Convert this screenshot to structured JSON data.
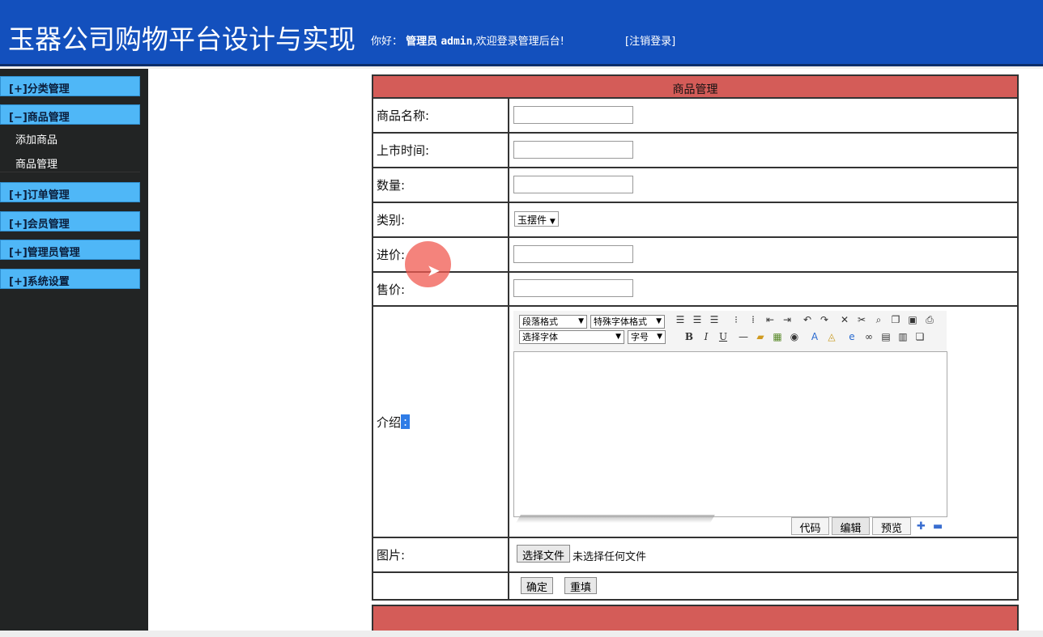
{
  "header": {
    "title": "玉器公司购物平台设计与实现",
    "greeting_prefix": "你好：",
    "role": "管理员",
    "username": "admin",
    "greeting_suffix": ",欢迎登录管理后台!",
    "logout": "[注销登录]"
  },
  "sidebar": {
    "menus": [
      {
        "label": "[+]分类管理"
      },
      {
        "label": "[−]商品管理"
      },
      {
        "label": "[+]订单管理"
      },
      {
        "label": "[+]会员管理"
      },
      {
        "label": "[+]管理员管理"
      },
      {
        "label": "[+]系统设置"
      }
    ],
    "sub_items": [
      {
        "label": "添加商品"
      },
      {
        "label": "商品管理"
      }
    ]
  },
  "form": {
    "title": "商品管理",
    "name_label": "商品名称:",
    "date_label": "上市时间:",
    "qty_label": "数量:",
    "category_label": "类别:",
    "category_value": "玉摆件",
    "cost_label": "进价:",
    "price_label": "售价:",
    "intro_label": "介绍",
    "intro_colon": ":",
    "image_label": "图片:",
    "choose_file": "选择文件",
    "no_file": "未选择任何文件",
    "submit": "确定",
    "reset": "重填"
  },
  "editor": {
    "paragraph_format": "段落格式",
    "special_font_format": "特殊字体格式",
    "choose_font": "选择字体",
    "font_size": "字号",
    "mode_code": "代码",
    "mode_edit": "编辑",
    "mode_preview": "预览"
  }
}
